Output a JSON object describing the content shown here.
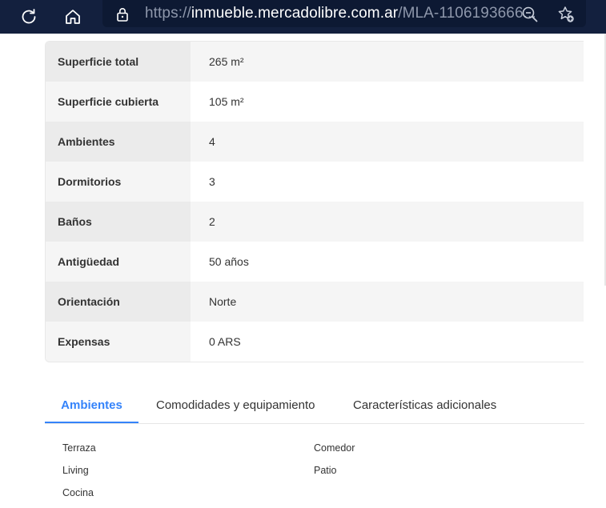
{
  "browser": {
    "url_prefix": "https://",
    "url_domain": "inmueble.mercadolibre.com.ar",
    "url_path": "/MLA-1106193666..."
  },
  "specs": [
    {
      "label": "Superficie total",
      "value": "265 m²"
    },
    {
      "label": "Superficie cubierta",
      "value": "105 m²"
    },
    {
      "label": "Ambientes",
      "value": "4"
    },
    {
      "label": "Dormitorios",
      "value": "3"
    },
    {
      "label": "Baños",
      "value": "2"
    },
    {
      "label": "Antigüedad",
      "value": "50 años"
    },
    {
      "label": "Orientación",
      "value": "Norte"
    },
    {
      "label": "Expensas",
      "value": "0 ARS"
    }
  ],
  "tabs": [
    {
      "label": "Ambientes",
      "active": true
    },
    {
      "label": "Comodidades y equipamiento",
      "active": false
    },
    {
      "label": "Características adicionales",
      "active": false
    }
  ],
  "features": {
    "col1": [
      "Terraza",
      "Living",
      "Cocina"
    ],
    "col2": [
      "Comedor",
      "Patio"
    ]
  },
  "colors": {
    "accent": "#3483fa",
    "topbar": "#13203e"
  }
}
